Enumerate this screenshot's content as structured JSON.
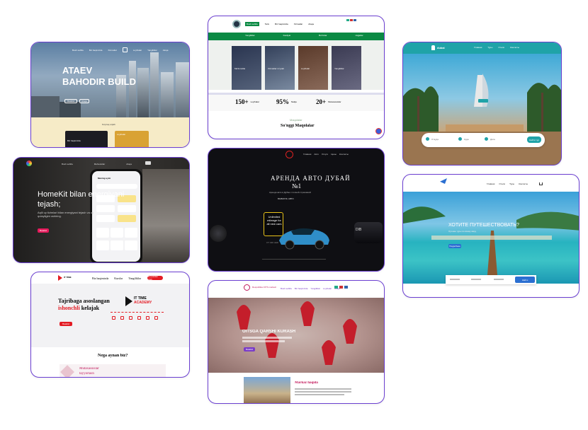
{
  "card1": {
    "nav": [
      "Bosh sahifa",
      "Biz haqimizda",
      "Xizmatlar",
      "Loyihalar",
      "Yangiliklar",
      "Aloqa"
    ],
    "title1": "ATAEV",
    "title2": "BAHODIR BUILD",
    "btn1": "Batafsil",
    "btn2": "Aloqa",
    "more": "Ko'proq o'qish",
    "item1": "Biz haqimizda",
    "item2": "Loyihalar"
  },
  "card2": {
    "topnav": [
      "Bosh sahifa",
      "Tarix",
      "Biz haqimizda",
      "Xizmatlar",
      "Aloqa"
    ],
    "greennav": [
      "Yangiliklar",
      "Faoliyat",
      "Bo'limlar",
      "Hujjatlar"
    ],
    "tiles": [
      "Ma'lumotlar",
      "Xizmatlar ro'yxati",
      "Loyihalar",
      "Yangiliklar"
    ],
    "stats": [
      {
        "num": "150+",
        "label": "Loyihalar"
      },
      {
        "num": "95%",
        "label": "Natija"
      },
      {
        "num": "20+",
        "label": "Mutaxassislar"
      }
    ],
    "section_small": "Maqolalar",
    "section_title": "So'nggi Maqolalar"
  },
  "card3": {
    "brand": "dubai",
    "nav": [
      "Главная",
      "Туры",
      "Отели",
      "Контакты"
    ],
    "search_labels": [
      "Откуда",
      "Куда",
      "Дата"
    ],
    "search_button": "Найти тур"
  },
  "card4": {
    "nav": [
      "Bosh sahifa",
      "Mahsulotlar",
      "Aloqa"
    ],
    "title1": "HomeKit bilan energiyani",
    "title2": "tejash;",
    "body": "Aqlli uy tizimlari bilan energiyani tejash va uy qulayligini oshiring.",
    "cta": "Batafsil",
    "phone_header": "Mening uyim"
  },
  "card5": {
    "nav": [
      "Главная",
      "Авто",
      "Услуги",
      "Цены",
      "Контакты"
    ],
    "title1": "АРЕНДА АВТО ДУБАЙ",
    "title2": "№1",
    "subtitle": "Аренда авто в Дубае с полной страховкой",
    "cta": "ВЫБРАТЬ АВТО",
    "badge": "Unlimited mileage for all new cars",
    "plate": "DIB",
    "price": "ОТ 400 AED"
  },
  "card6": {
    "nav": [
      "Главная",
      "Отели",
      "Туры",
      "Контакты"
    ],
    "title": "ХОТИТЕ ПУТЕШЕСТВОВАТЬ?",
    "subtitle": "Лучшие туры по всему миру",
    "cta": "Подробнее",
    "search_button": "Найти"
  },
  "card7": {
    "logo": "IT TIME",
    "nav": [
      "Biz haqimizda",
      "Kurslar",
      "Yangiliklar"
    ],
    "nav_button": "Ro'yxatdan o'tish",
    "title1": "Tajribaga asoslangan",
    "title2_red": "ishonchli",
    "title2_rest": " kelajak",
    "cta": "Batafsil",
    "academy1": "IT TIME",
    "academy2": "ACADEMY",
    "why": "Nega aynan biz?",
    "promo1": "Mutaxassislar",
    "promo2": "tayyorlash"
  },
  "card8": {
    "header_text": "Respublika OITS markazi",
    "nav": [
      "Bosh sahifa",
      "Biz haqimizda",
      "Yangiliklar",
      "Loyihalar",
      "Aloqa"
    ],
    "banner": "OITSGA QARSHI KURASH",
    "banner_button": "Batafsil",
    "section_title": "Markaz haqida"
  }
}
